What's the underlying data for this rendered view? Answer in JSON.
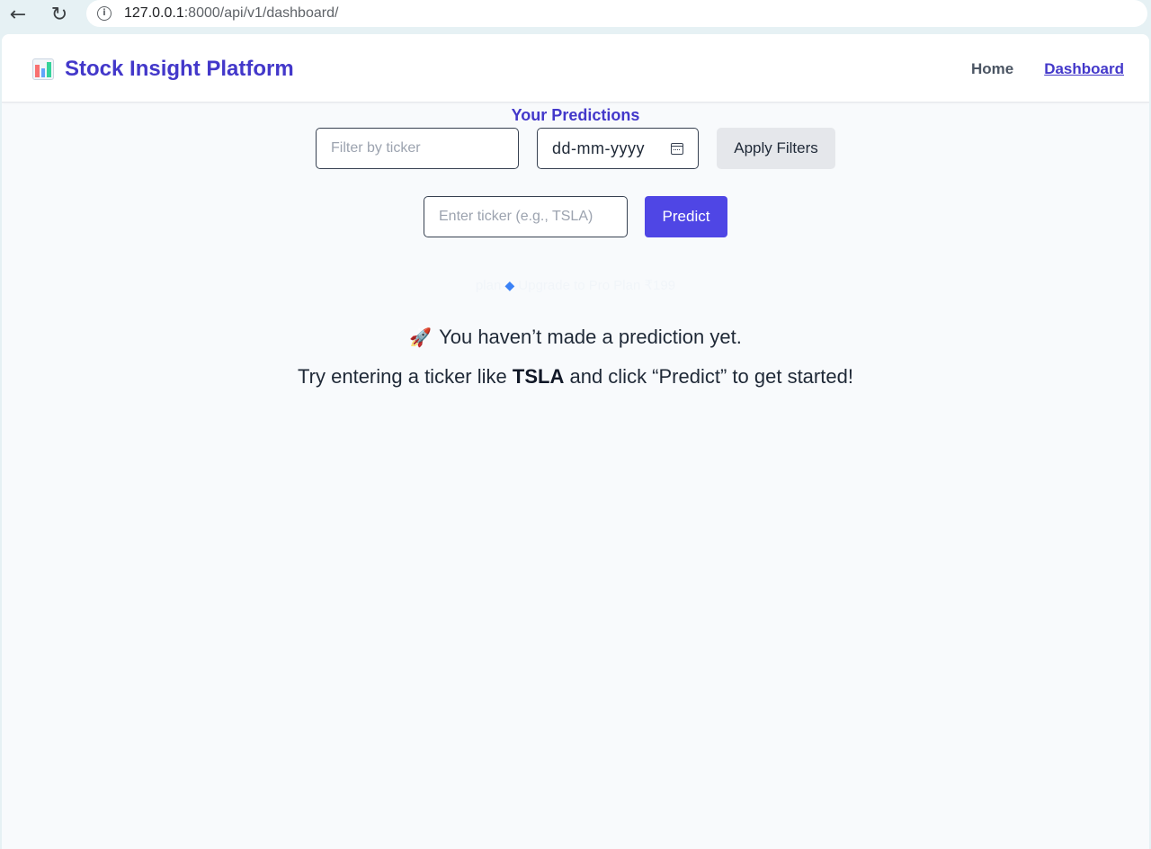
{
  "browser": {
    "url_host": "127.0.0.1",
    "url_rest": ":8000/api/v1/dashboard/",
    "back_icon": "←",
    "reload_icon": "↻",
    "info_icon": "i"
  },
  "header": {
    "title": "Stock Insight Platform",
    "nav": {
      "home": "Home",
      "dashboard": "Dashboard"
    }
  },
  "filters": {
    "heading": "Your Predictions",
    "ticker_placeholder": "Filter by ticker",
    "date_placeholder": "dd-mm-yyyy",
    "apply_label": "Apply Filters"
  },
  "predict": {
    "ticker_placeholder": "Enter ticker (e.g., TSLA)",
    "button_label": "Predict"
  },
  "upgrade": {
    "prefix": "plan",
    "gem_icon": "◆",
    "text": "Upgrade to Pro Plan ₹199"
  },
  "empty_state": {
    "rocket_icon": "🚀",
    "message": "You haven’t made a prediction yet.",
    "hint_before": "Try entering a ticker like",
    "hint_ticker": "TSLA",
    "hint_after": "and click “Predict” to get started!"
  },
  "colors": {
    "accent": "#4338ca",
    "button": "#4f46e5",
    "brand_bars": [
      "#f87171",
      "#60a5fa",
      "#34d399"
    ]
  }
}
